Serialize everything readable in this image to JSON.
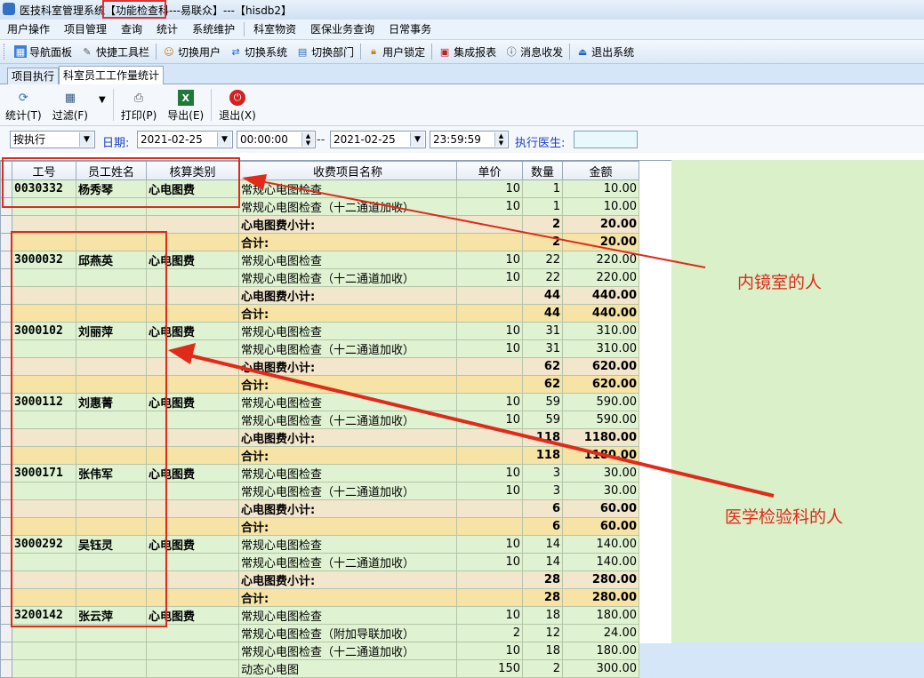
{
  "window": {
    "title_part1": "医技科室管理系统",
    "title_part2": "【功能检查科---易联众】---【hisdb2】"
  },
  "menu": [
    "用户操作",
    "项目管理",
    "查询",
    "统计",
    "系统维护",
    "科室物资",
    "医保业务查询",
    "日常事务"
  ],
  "toolbar": [
    {
      "label": "导航面板",
      "icon": "navigation-icon"
    },
    {
      "label": "快捷工具栏",
      "icon": "tools-icon"
    },
    {
      "label": "切换用户",
      "icon": "users-icon"
    },
    {
      "label": "切换系统",
      "icon": "switch-system-icon"
    },
    {
      "label": "切换部门",
      "icon": "department-icon"
    },
    {
      "label": "用户锁定",
      "icon": "lock-icon"
    },
    {
      "label": "集成报表",
      "icon": "report-icon"
    },
    {
      "label": "消息收发",
      "icon": "message-icon"
    },
    {
      "label": "退出系统",
      "icon": "exit-icon"
    }
  ],
  "tabs": [
    "项目执行",
    "科室员工工作量统计"
  ],
  "actions": {
    "stats": "统计(T)",
    "filter": "过滤(F)",
    "print": "打印(P)",
    "export": "导出(E)",
    "exit": "退出(X)"
  },
  "filters": {
    "mode": "按执行",
    "date_label": "日期:",
    "start_date": "2021-02-25",
    "start_time": "00:00:00",
    "range_sep": "--",
    "end_date": "2021-02-25",
    "end_time": "23:59:59",
    "doctor_label": "执行医生:",
    "doctor_value": ""
  },
  "table": {
    "headers": [
      "工号",
      "员工姓名",
      "核算类别",
      "收费项目名称",
      "单价",
      "数量",
      "金额"
    ],
    "rows": [
      {
        "type": "item",
        "id": "0030332",
        "name": "杨秀琴",
        "category": "心电图费",
        "item": "常规心电图检查",
        "price": "10",
        "qty": "1",
        "amount": "10.00"
      },
      {
        "type": "item",
        "id": "",
        "name": "",
        "category": "",
        "item": "常规心电图检查（十二通道加收）",
        "price": "10",
        "qty": "1",
        "amount": "10.00"
      },
      {
        "type": "subtotal",
        "item": "心电图费小计:",
        "qty": "2",
        "amount": "20.00"
      },
      {
        "type": "total",
        "item": "合计:",
        "qty": "2",
        "amount": "20.00"
      },
      {
        "type": "item",
        "id": "3000032",
        "name": "邱燕英",
        "category": "心电图费",
        "item": "常规心电图检查",
        "price": "10",
        "qty": "22",
        "amount": "220.00"
      },
      {
        "type": "item",
        "id": "",
        "name": "",
        "category": "",
        "item": "常规心电图检查（十二通道加收）",
        "price": "10",
        "qty": "22",
        "amount": "220.00"
      },
      {
        "type": "subtotal",
        "item": "心电图费小计:",
        "qty": "44",
        "amount": "440.00"
      },
      {
        "type": "total",
        "item": "合计:",
        "qty": "44",
        "amount": "440.00"
      },
      {
        "type": "item",
        "id": "3000102",
        "name": "刘丽萍",
        "category": "心电图费",
        "item": "常规心电图检查",
        "price": "10",
        "qty": "31",
        "amount": "310.00"
      },
      {
        "type": "item",
        "id": "",
        "name": "",
        "category": "",
        "item": "常规心电图检查（十二通道加收）",
        "price": "10",
        "qty": "31",
        "amount": "310.00"
      },
      {
        "type": "subtotal",
        "item": "心电图费小计:",
        "qty": "62",
        "amount": "620.00"
      },
      {
        "type": "total",
        "item": "合计:",
        "qty": "62",
        "amount": "620.00"
      },
      {
        "type": "item",
        "id": "3000112",
        "name": "刘惠菁",
        "category": "心电图费",
        "item": "常规心电图检查",
        "price": "10",
        "qty": "59",
        "amount": "590.00"
      },
      {
        "type": "item",
        "id": "",
        "name": "",
        "category": "",
        "item": "常规心电图检查（十二通道加收）",
        "price": "10",
        "qty": "59",
        "amount": "590.00"
      },
      {
        "type": "subtotal",
        "item": "心电图费小计:",
        "qty": "118",
        "amount": "1180.00"
      },
      {
        "type": "total",
        "item": "合计:",
        "qty": "118",
        "amount": "1180.00"
      },
      {
        "type": "item",
        "id": "3000171",
        "name": "张伟军",
        "category": "心电图费",
        "item": "常规心电图检查",
        "price": "10",
        "qty": "3",
        "amount": "30.00"
      },
      {
        "type": "item",
        "id": "",
        "name": "",
        "category": "",
        "item": "常规心电图检查（十二通道加收）",
        "price": "10",
        "qty": "3",
        "amount": "30.00"
      },
      {
        "type": "subtotal",
        "item": "心电图费小计:",
        "qty": "6",
        "amount": "60.00"
      },
      {
        "type": "total",
        "item": "合计:",
        "qty": "6",
        "amount": "60.00"
      },
      {
        "type": "item",
        "id": "3000292",
        "name": "吴钰灵",
        "category": "心电图费",
        "item": "常规心电图检查",
        "price": "10",
        "qty": "14",
        "amount": "140.00"
      },
      {
        "type": "item",
        "id": "",
        "name": "",
        "category": "",
        "item": "常规心电图检查（十二通道加收）",
        "price": "10",
        "qty": "14",
        "amount": "140.00"
      },
      {
        "type": "subtotal",
        "item": "心电图费小计:",
        "qty": "28",
        "amount": "280.00"
      },
      {
        "type": "total",
        "item": "合计:",
        "qty": "28",
        "amount": "280.00"
      },
      {
        "type": "item",
        "id": "3200142",
        "name": "张云萍",
        "category": "心电图费",
        "item": "常规心电图检查",
        "price": "10",
        "qty": "18",
        "amount": "180.00"
      },
      {
        "type": "item",
        "id": "",
        "name": "",
        "category": "",
        "item": "常规心电图检查（附加导联加收）",
        "price": "2",
        "qty": "12",
        "amount": "24.00"
      },
      {
        "type": "item",
        "id": "",
        "name": "",
        "category": "",
        "item": "常规心电图检查（十二通道加收）",
        "price": "10",
        "qty": "18",
        "amount": "180.00"
      },
      {
        "type": "item",
        "id": "",
        "name": "",
        "category": "",
        "item": "动态心电图",
        "price": "150",
        "qty": "2",
        "amount": "300.00"
      }
    ]
  },
  "annotations": {
    "endoscopy": "内镜室的人",
    "lab": "医学检验科的人",
    "color": "#e02a1a"
  }
}
